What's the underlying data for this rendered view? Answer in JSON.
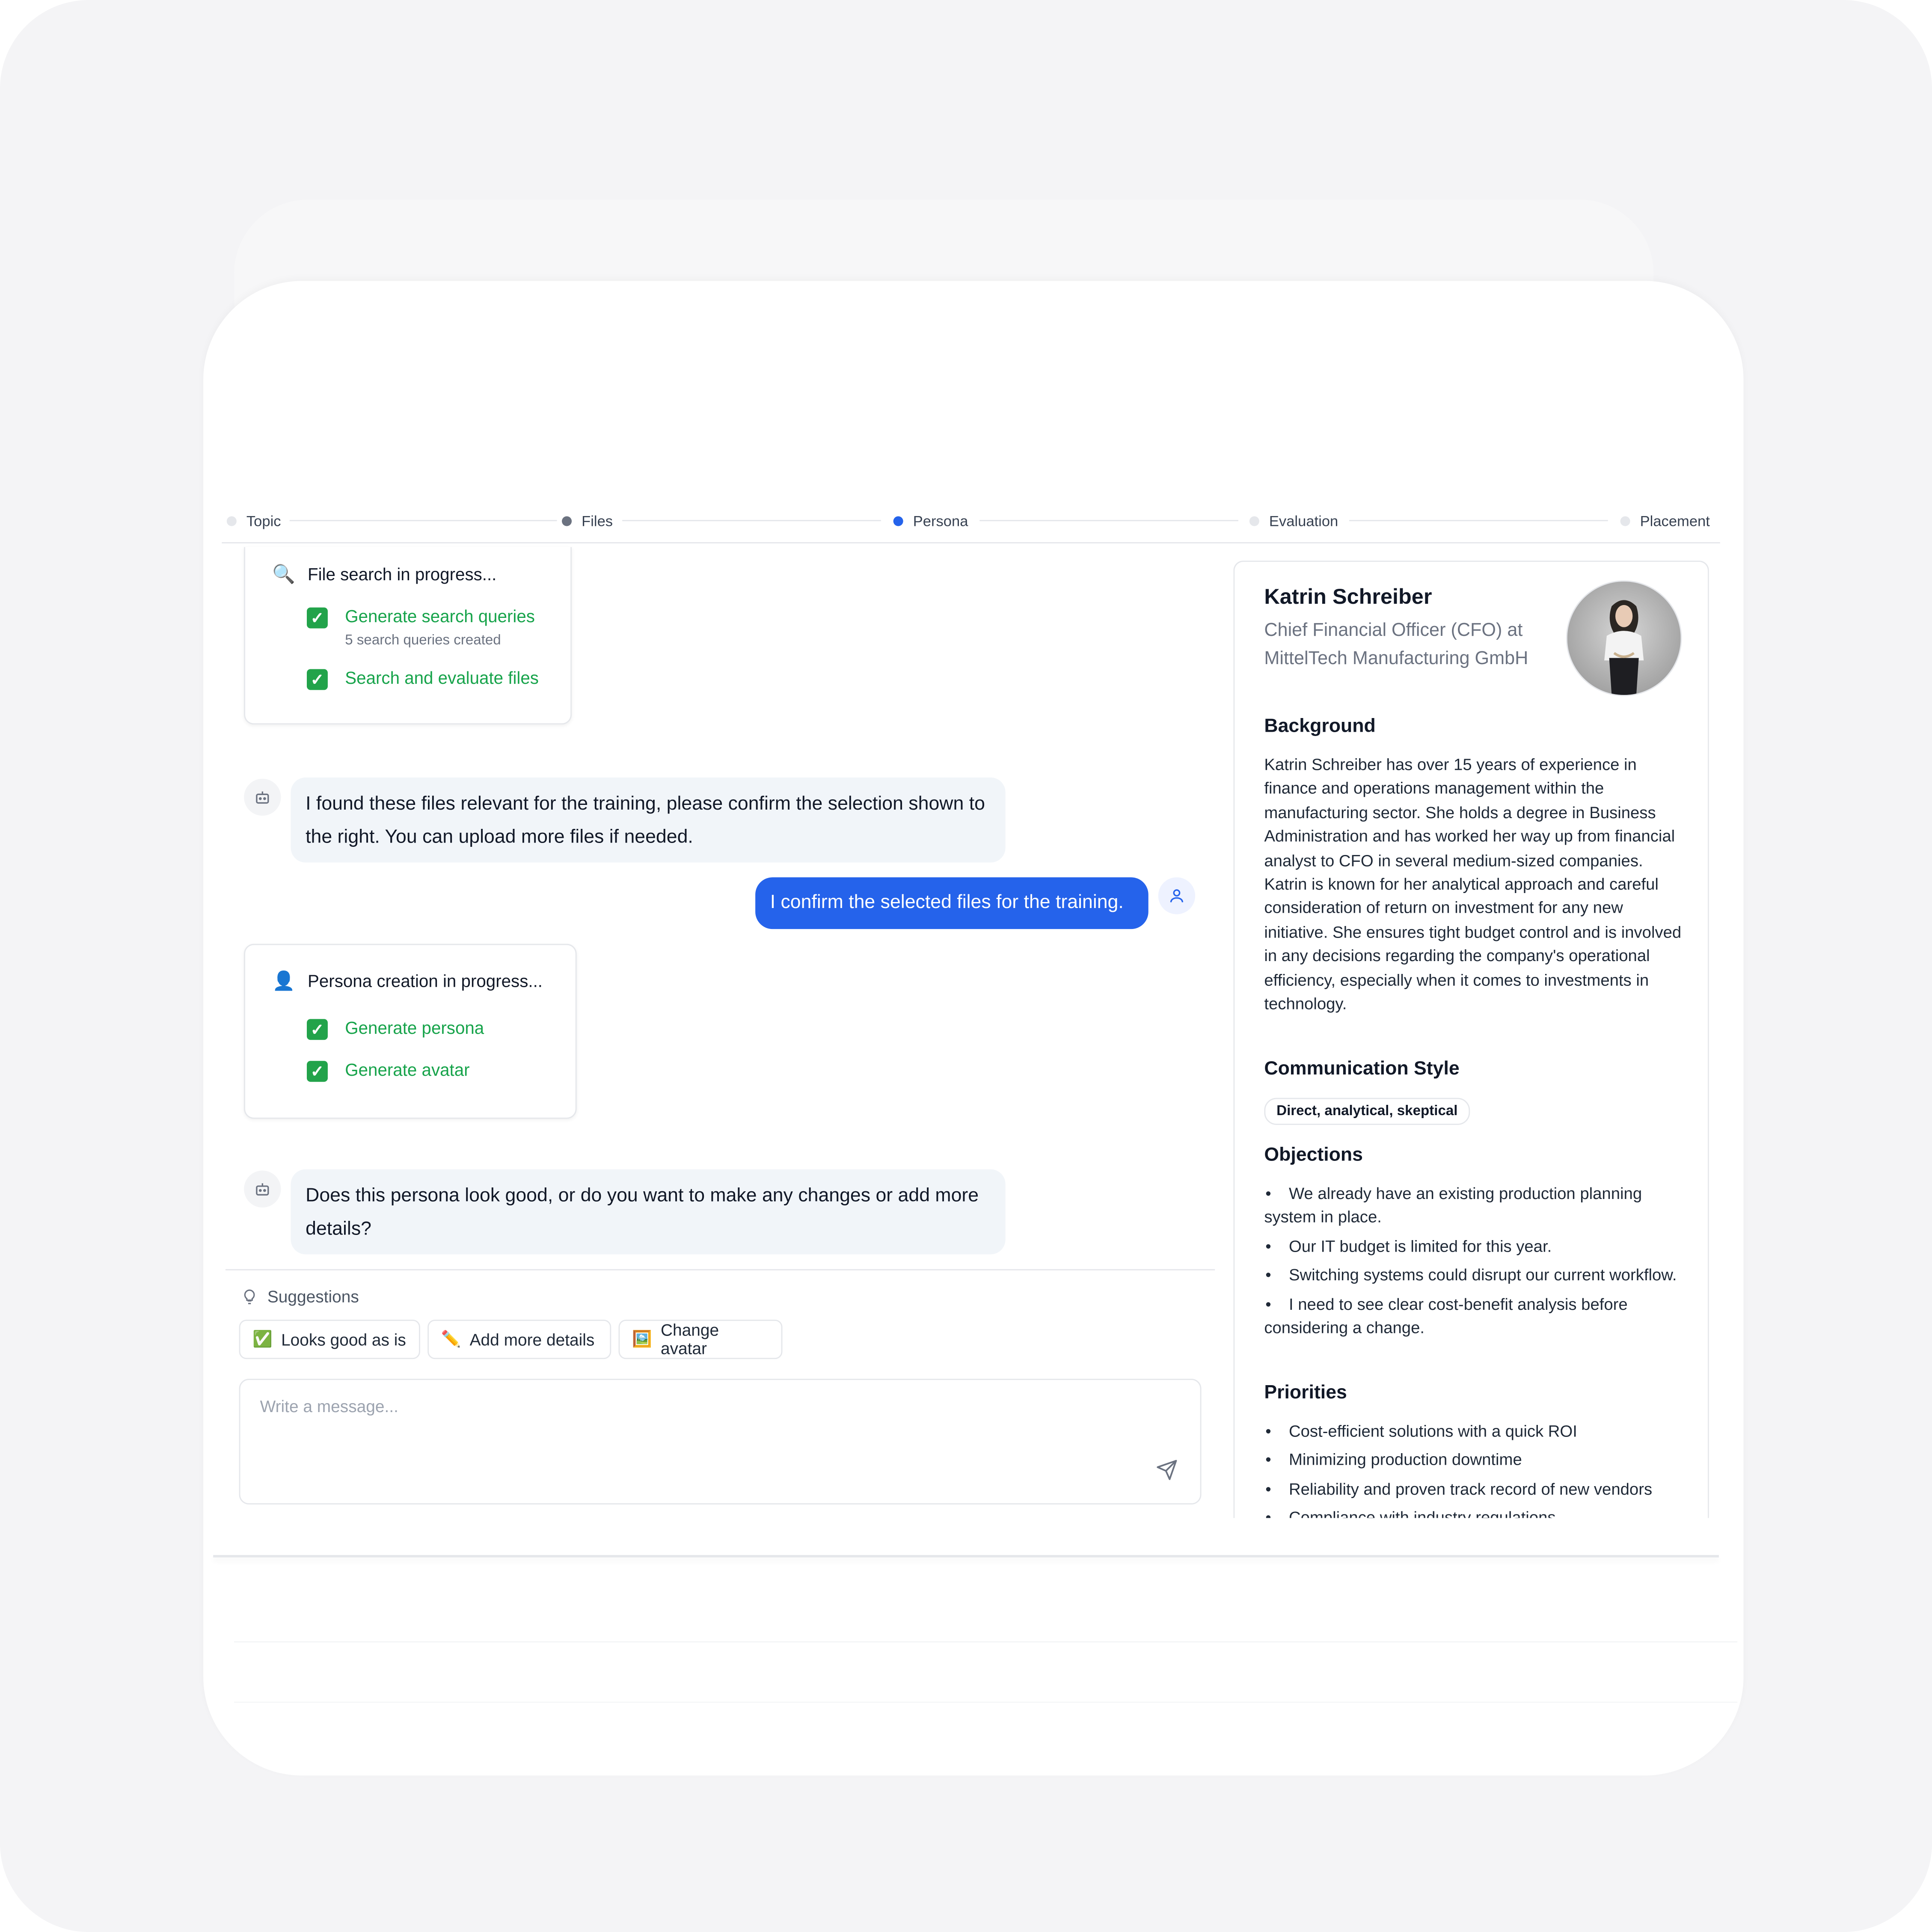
{
  "stepper": {
    "steps": [
      {
        "label": "Topic",
        "state": "pending"
      },
      {
        "label": "Files",
        "state": "done"
      },
      {
        "label": "Persona",
        "state": "active"
      },
      {
        "label": "Evaluation",
        "state": "pending"
      },
      {
        "label": "Placement",
        "state": "pending"
      }
    ]
  },
  "file_search": {
    "title": "File search in progress...",
    "tasks": [
      {
        "label": "Generate search queries",
        "detail": "5 search queries created"
      },
      {
        "label": "Search and evaluate files"
      }
    ]
  },
  "messages": [
    {
      "role": "bot",
      "text": "I found these files relevant for the training, please confirm the selection shown to the right. You can upload more files if needed."
    },
    {
      "role": "user",
      "text": "I confirm the selected files for the training."
    },
    {
      "role": "bot",
      "text": "Does this persona look good, or do you want to make any changes or add more details?"
    }
  ],
  "persona_creation": {
    "title": "Persona creation in progress...",
    "tasks": [
      {
        "label": "Generate persona"
      },
      {
        "label": "Generate avatar"
      }
    ]
  },
  "suggestions": {
    "heading": "Suggestions",
    "items": [
      {
        "emoji": "✅",
        "label": "Looks good as is"
      },
      {
        "emoji": "✏️",
        "label": "Add more details"
      },
      {
        "emoji": "🖼️",
        "label": "Change avatar"
      }
    ]
  },
  "composer": {
    "placeholder": "Write a message...",
    "value": ""
  },
  "persona": {
    "name": "Katrin Schreiber",
    "role": "Chief Financial Officer (CFO) at MittelTech Manufacturing GmbH",
    "background_heading": "Background",
    "background": "Katrin Schreiber has over 15 years of experience in finance and operations management within the manufacturing sector. She holds a degree in Business Administration and has worked her way up from financial analyst to CFO in several medium-sized companies. Katrin is known for her analytical approach and careful consideration of return on investment for any new initiative. She ensures tight budget control and is involved in any decisions regarding the company's operational efficiency, especially when it comes to investments in technology.",
    "communication_heading": "Communication Style",
    "communication_style": "Direct, analytical, skeptical",
    "objections_heading": "Objections",
    "objections": [
      "We already have an existing production planning system in place.",
      "Our IT budget is limited for this year.",
      "Switching systems could disrupt our current workflow.",
      "I need to see clear cost-benefit analysis before considering a change."
    ],
    "priorities_heading": "Priorities",
    "priorities": [
      "Cost-efficient solutions with a quick ROI",
      "Minimizing production downtime",
      "Reliability and proven track record of new vendors",
      "Compliance with industry regulations"
    ]
  },
  "colors": {
    "accent": "#2563eb",
    "success": "#16a34a",
    "bot_bubble": "#f1f5f9"
  }
}
